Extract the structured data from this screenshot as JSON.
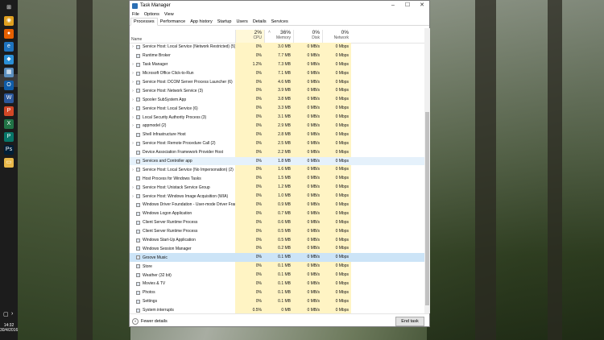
{
  "window": {
    "title": "Task Manager",
    "minimize": "–",
    "maximize": "☐",
    "close": "✕"
  },
  "menu": [
    "File",
    "Options",
    "View"
  ],
  "tabs": [
    "Processes",
    "Performance",
    "App history",
    "Startup",
    "Users",
    "Details",
    "Services"
  ],
  "header": {
    "name": "Name",
    "cpu": {
      "pct": "2%",
      "label": "CPU"
    },
    "memory": {
      "pct": "36%",
      "label": "Memory"
    },
    "disk": {
      "pct": "0%",
      "label": "Disk"
    },
    "network": {
      "pct": "0%",
      "label": "Network"
    }
  },
  "rows": [
    {
      "exp": "›",
      "name": "Service Host: Local Service (Network Restricted) (5)",
      "cpu": "0%",
      "mem": "3.0 MB",
      "disk": "0 MB/s",
      "net": "0 Mbps"
    },
    {
      "exp": "",
      "name": "Runtime Broker",
      "cpu": "0%",
      "mem": "7.7 MB",
      "disk": "0 MB/s",
      "net": "0 Mbps"
    },
    {
      "exp": "›",
      "name": "Task Manager",
      "cpu": "1.2%",
      "mem": "7.3 MB",
      "disk": "0 MB/s",
      "net": "0 Mbps"
    },
    {
      "exp": "›",
      "name": "Microsoft Office Click-to-Run",
      "cpu": "0%",
      "mem": "7.1 MB",
      "disk": "0 MB/s",
      "net": "0 Mbps"
    },
    {
      "exp": "›",
      "name": "Service Host: DCOM Server Process Launcher (6)",
      "cpu": "0%",
      "mem": "4.6 MB",
      "disk": "0 MB/s",
      "net": "0 Mbps"
    },
    {
      "exp": "›",
      "name": "Service Host: Network Service (3)",
      "cpu": "0%",
      "mem": "3.9 MB",
      "disk": "0 MB/s",
      "net": "0 Mbps"
    },
    {
      "exp": "›",
      "name": "Spooler SubSystem App",
      "cpu": "0%",
      "mem": "3.8 MB",
      "disk": "0 MB/s",
      "net": "0 Mbps"
    },
    {
      "exp": "›",
      "name": "Service Host: Local Service (6)",
      "cpu": "0%",
      "mem": "3.3 MB",
      "disk": "0 MB/s",
      "net": "0 Mbps"
    },
    {
      "exp": "›",
      "name": "Local Security Authority Process (3)",
      "cpu": "0%",
      "mem": "3.1 MB",
      "disk": "0 MB/s",
      "net": "0 Mbps"
    },
    {
      "exp": "›",
      "name": "appmodel (2)",
      "cpu": "0%",
      "mem": "2.9 MB",
      "disk": "0 MB/s",
      "net": "0 Mbps"
    },
    {
      "exp": "",
      "name": "Shell Infrastructure Host",
      "cpu": "0%",
      "mem": "2.8 MB",
      "disk": "0 MB/s",
      "net": "0 Mbps"
    },
    {
      "exp": "›",
      "name": "Service Host: Remote Procedure Call (2)",
      "cpu": "0%",
      "mem": "2.5 MB",
      "disk": "0 MB/s",
      "net": "0 Mbps"
    },
    {
      "exp": "",
      "name": "Device Association Framework Provider Host",
      "cpu": "0%",
      "mem": "2.2 MB",
      "disk": "0 MB/s",
      "net": "0 Mbps"
    },
    {
      "exp": "",
      "name": "Services and Controller app",
      "cpu": "0%",
      "mem": "1.8 MB",
      "disk": "0 MB/s",
      "net": "0 Mbps",
      "state": "hl"
    },
    {
      "exp": "›",
      "name": "Service Host: Local Service (No Impersonation) (2)",
      "cpu": "0%",
      "mem": "1.6 MB",
      "disk": "0 MB/s",
      "net": "0 Mbps"
    },
    {
      "exp": "",
      "name": "Host Process for Windows Tasks",
      "cpu": "0%",
      "mem": "1.5 MB",
      "disk": "0 MB/s",
      "net": "0 Mbps"
    },
    {
      "exp": "›",
      "name": "Service Host: Unistack Service Group",
      "cpu": "0%",
      "mem": "1.2 MB",
      "disk": "0 MB/s",
      "net": "0 Mbps"
    },
    {
      "exp": "›",
      "name": "Service Host: Windows Image Acquisition (WIA)",
      "cpu": "0%",
      "mem": "1.0 MB",
      "disk": "0 MB/s",
      "net": "0 Mbps"
    },
    {
      "exp": "",
      "name": "Windows Driver Foundation - User-mode Driver Frame...",
      "cpu": "0%",
      "mem": "0.9 MB",
      "disk": "0 MB/s",
      "net": "0 Mbps"
    },
    {
      "exp": "",
      "name": "Windows Logon Application",
      "cpu": "0%",
      "mem": "0.7 MB",
      "disk": "0 MB/s",
      "net": "0 Mbps"
    },
    {
      "exp": "",
      "name": "Client Server Runtime Process",
      "cpu": "0%",
      "mem": "0.6 MB",
      "disk": "0 MB/s",
      "net": "0 Mbps"
    },
    {
      "exp": "",
      "name": "Client Server Runtime Process",
      "cpu": "0%",
      "mem": "0.5 MB",
      "disk": "0 MB/s",
      "net": "0 Mbps"
    },
    {
      "exp": "",
      "name": "Windows Start-Up Application",
      "cpu": "0%",
      "mem": "0.5 MB",
      "disk": "0 MB/s",
      "net": "0 Mbps"
    },
    {
      "exp": "",
      "name": "Windows Session Manager",
      "cpu": "0%",
      "mem": "0.2 MB",
      "disk": "0 MB/s",
      "net": "0 Mbps"
    },
    {
      "exp": "",
      "name": "Groove Music",
      "cpu": "0%",
      "mem": "0.1 MB",
      "disk": "0 MB/s",
      "net": "0 Mbps",
      "state": "sel"
    },
    {
      "exp": "",
      "name": "Store",
      "cpu": "0%",
      "mem": "0.1 MB",
      "disk": "0 MB/s",
      "net": "0 Mbps"
    },
    {
      "exp": "",
      "name": "Weather (32 bit)",
      "cpu": "0%",
      "mem": "0.1 MB",
      "disk": "0 MB/s",
      "net": "0 Mbps"
    },
    {
      "exp": "",
      "name": "Movies & TV",
      "cpu": "0%",
      "mem": "0.1 MB",
      "disk": "0 MB/s",
      "net": "0 Mbps"
    },
    {
      "exp": "",
      "name": "Photos",
      "cpu": "0%",
      "mem": "0.1 MB",
      "disk": "0 MB/s",
      "net": "0 Mbps"
    },
    {
      "exp": "",
      "name": "Settings",
      "cpu": "0%",
      "mem": "0.1 MB",
      "disk": "0 MB/s",
      "net": "0 Mbps"
    },
    {
      "exp": "",
      "name": "System interrupts",
      "cpu": "0.5%",
      "mem": "0 MB",
      "disk": "0 MB/s",
      "net": "0 Mbps"
    }
  ],
  "footer": {
    "fewer_details": "Fewer details",
    "end_task": "End task"
  },
  "taskbar": {
    "icons": [
      {
        "icon": "windows-start-icon",
        "color": "#1c1c1c",
        "glyph": "⊞"
      },
      {
        "icon": "chrome-icon",
        "color": "#e0a020",
        "glyph": "◉"
      },
      {
        "icon": "firefox-icon",
        "color": "#e66000",
        "glyph": "●"
      },
      {
        "icon": "edge-icon",
        "color": "#1e73be",
        "glyph": "e"
      },
      {
        "icon": "app-icon",
        "color": "#2a8fd6",
        "glyph": "◆"
      },
      {
        "icon": "task-manager-icon",
        "color": "#5c8fbf",
        "glyph": "▦"
      },
      {
        "icon": "outlook-icon",
        "color": "#0f5ca8",
        "glyph": "O"
      },
      {
        "icon": "word-icon",
        "color": "#2b579a",
        "glyph": "W"
      },
      {
        "icon": "powerpoint-icon",
        "color": "#d24726",
        "glyph": "P"
      },
      {
        "icon": "excel-icon",
        "color": "#217346",
        "glyph": "X"
      },
      {
        "icon": "publisher-icon",
        "color": "#077568",
        "glyph": "P"
      },
      {
        "icon": "photoshop-icon",
        "color": "#001e36",
        "glyph": "Ps"
      },
      {
        "icon": "file-explorer-icon",
        "color": "#e8b84a",
        "glyph": "▭"
      }
    ],
    "time": "14:32",
    "date": "30/4/2016",
    "notification_glyph": "▢",
    "arrow_glyph": "›"
  }
}
